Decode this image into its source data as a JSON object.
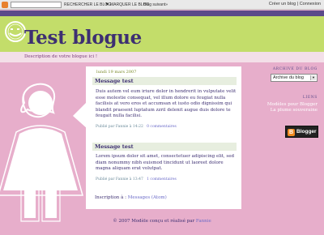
{
  "navbar": {
    "search_blog": "RECHERCHER LE BLOG",
    "flag_blog": "MARQUER LE BLOG",
    "next_blog": "Blog suivant»",
    "create_blog": "Créer un blog",
    "separator": "|",
    "login": "Connexion"
  },
  "header": {
    "title": "Test blogue",
    "description": "Description de votre blogue ici !"
  },
  "posts": [
    {
      "date": "lundi 19 mars 2007",
      "title": "Message test",
      "body": "Duis autem vel eum iriure dolor in hendrerit in vulputate velit esse molestie consequat, vel illum dolore eu feugiat nulla facilisis at vero eros et accumsan et iusto odio dignissim qui blandit praesent luptatum zzril delenit augue duis dolore te feugait nulla facilisi.",
      "byline": "Publié par Fannie à 14:22",
      "comments": "0 commentaires"
    },
    {
      "title": "Message test",
      "body": "Lorem ipsum dolor sit amet, consectetuer adipiscing elit, sed diam nonummy nibh euismod tincidunt ut laoreet dolore magna aliquam erat volutpat.",
      "byline": "Publié par Fannie à 13:47",
      "comments": "1 commentaires"
    }
  ],
  "subscribe": {
    "label": "Inscription à :",
    "link": "Messages (Atom)"
  },
  "sidebar": {
    "archive_title": "ARCHIVE DU BLOG",
    "archive_select": "Archive du blog",
    "links_title": "LIENS",
    "links": [
      "Modèles pour Blogger",
      "La plume souveraine"
    ],
    "badge": "Blogger"
  },
  "footer": {
    "text": "© 2007 Modèle conçu et réalisé par",
    "author": "Fannie"
  },
  "colors": {
    "background": "#e7aecb",
    "header": "#c3dd6a",
    "accent": "#3d2f72"
  }
}
